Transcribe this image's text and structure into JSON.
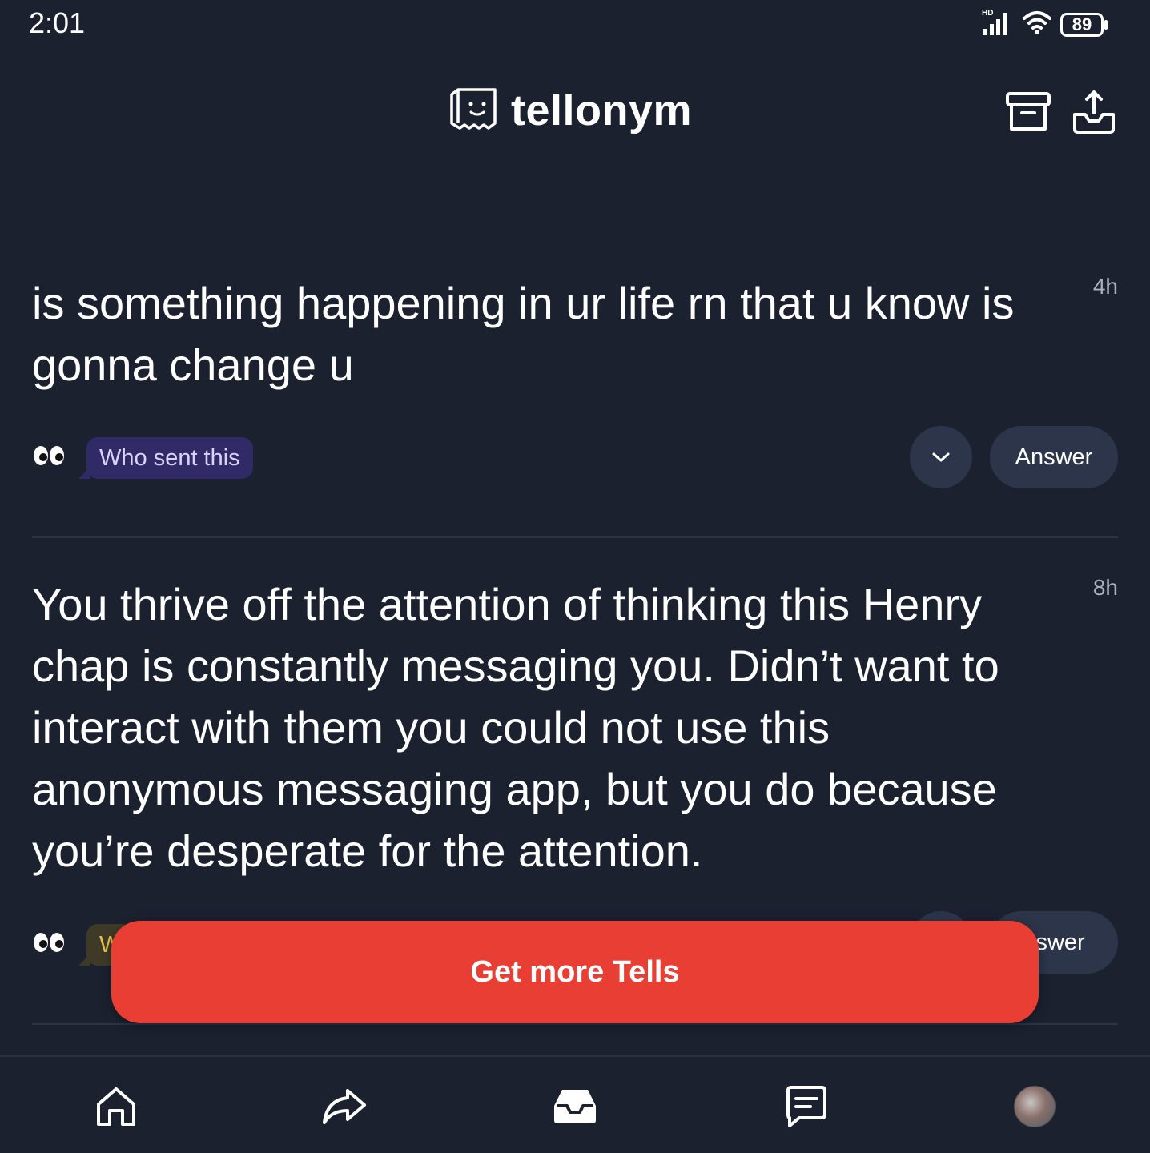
{
  "status_bar": {
    "time": "2:01",
    "network_label": "HD",
    "battery": "89"
  },
  "header": {
    "app_name": "tellonym"
  },
  "tells": [
    {
      "text": "is something happening in ur life rn that u know is gonna change u",
      "time": "4h",
      "who_sent_label": "Who sent this",
      "answer_label": "Answer",
      "chip_style": "purple"
    },
    {
      "text": "You thrive off the attention of thinking this Henry chap is constantly messaging you. Didn’t want to interact with them you could not use this anonymous messaging app, but you do because you’re desperate for the attention.",
      "time": "8h",
      "who_sent_label": "W",
      "answer_label": "nswer",
      "chip_style": "yellow"
    }
  ],
  "cta": {
    "label": "Get more Tells"
  },
  "nav": {
    "items": [
      "home-icon",
      "share-icon",
      "inbox-icon",
      "chat-icon",
      "profile-avatar"
    ],
    "active": "inbox-icon"
  },
  "colors": {
    "background": "#1c2130",
    "button_bg": "#2c3549",
    "cta": "#e83e33",
    "who_chip": "#302b67"
  }
}
